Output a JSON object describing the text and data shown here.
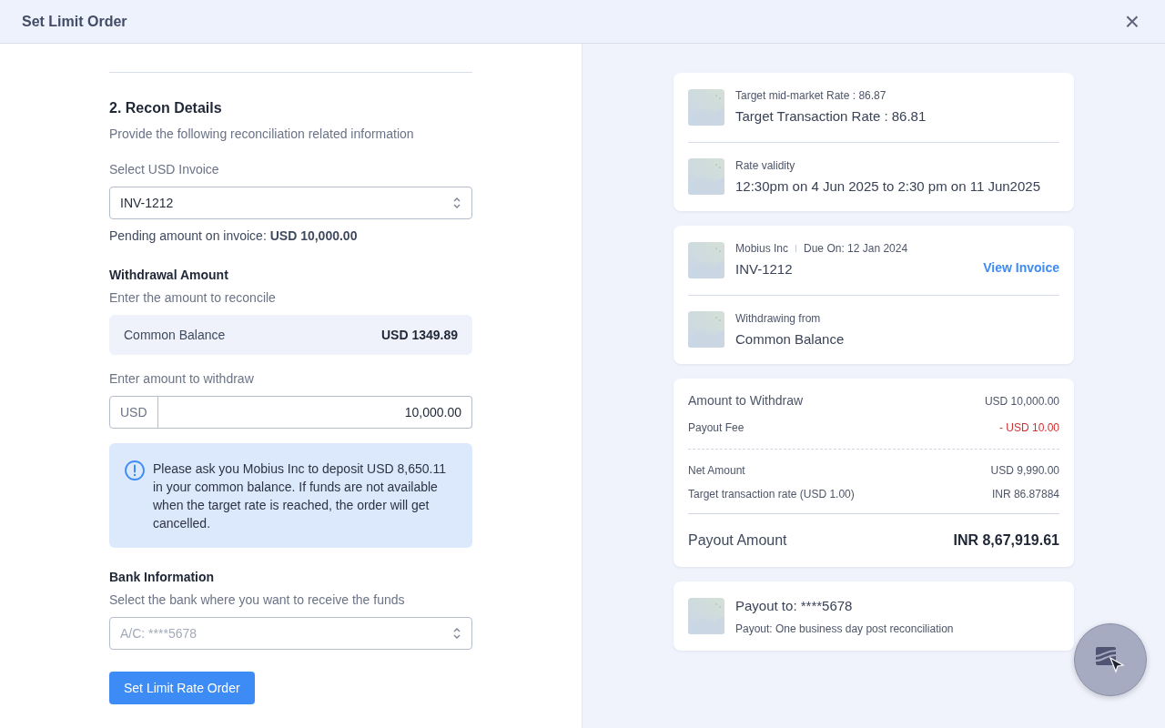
{
  "window": {
    "title": "Set Limit Order",
    "close": "×"
  },
  "recon": {
    "heading": "2. Recon Details",
    "subtitle": "Provide the following reconciliation related information",
    "invoice_select": {
      "label": "Select USD Invoice",
      "value": "INV-1212"
    },
    "pending": {
      "text": "Pending amount on invoice: **USD 10,000.00**"
    },
    "withdrawal": {
      "heading": "Withdrawal Amount",
      "subtitle": "Enter the amount to reconcile",
      "balance_label": "Common Balance",
      "balance_value": "USD 1349.89",
      "amount_label": "Enter amount to withdraw",
      "currency": "USD",
      "amount": "10,000.00"
    },
    "alert": {
      "text": "Please ask you Mobius Inc to deposit USD 8,650.11 in your common balance. If funds are not available when the target rate is reached, the order will get cancelled."
    },
    "bank": {
      "heading": "Bank Information",
      "subtitle": "Select the bank where you want to receive the funds",
      "placeholder": "A/C: ****5678"
    },
    "submit": "Set Limit Rate Order"
  },
  "summary_cards": [
    {
      "items": [
        {
          "small": "Target mid-market Rate : 86.87",
          "main": "Target Transaction Rate : 86.81"
        },
        {
          "small": "Rate validity",
          "main": "12:30pm on 4 Jun 2025 to 2:30 pm on 11 Jun2025"
        }
      ]
    },
    {
      "items": [
        {
          "small": "Mobius Inc",
          "small_2": "Due On: 12 Jan 2024",
          "main": "INV-1212",
          "link": "View Invoice"
        },
        {
          "small": "Withdrawing from",
          "main": "Common Balance"
        }
      ]
    }
  ],
  "breakdown": {
    "rows": [
      {
        "label": "Amount to Withdraw",
        "value": "USD 10,000.00",
        "negative": false,
        "kind": "major"
      },
      {
        "label": "Payout Fee",
        "value": "- USD 10.00",
        "negative": true,
        "kind": "minor"
      },
      {
        "label": "Net Amount",
        "value": "USD 9,990.00",
        "negative": false,
        "kind": "minor"
      },
      {
        "label": "Target transaction rate (USD  1.00)",
        "value": "INR 86.87884",
        "negative": false,
        "kind": "minor"
      }
    ],
    "total": {
      "label": "Payout Amount",
      "value": "INR 8,67,919.61"
    }
  },
  "payout": {
    "main": "Payout to: ****5678",
    "small": "Payout: One business day post reconciliation"
  }
}
